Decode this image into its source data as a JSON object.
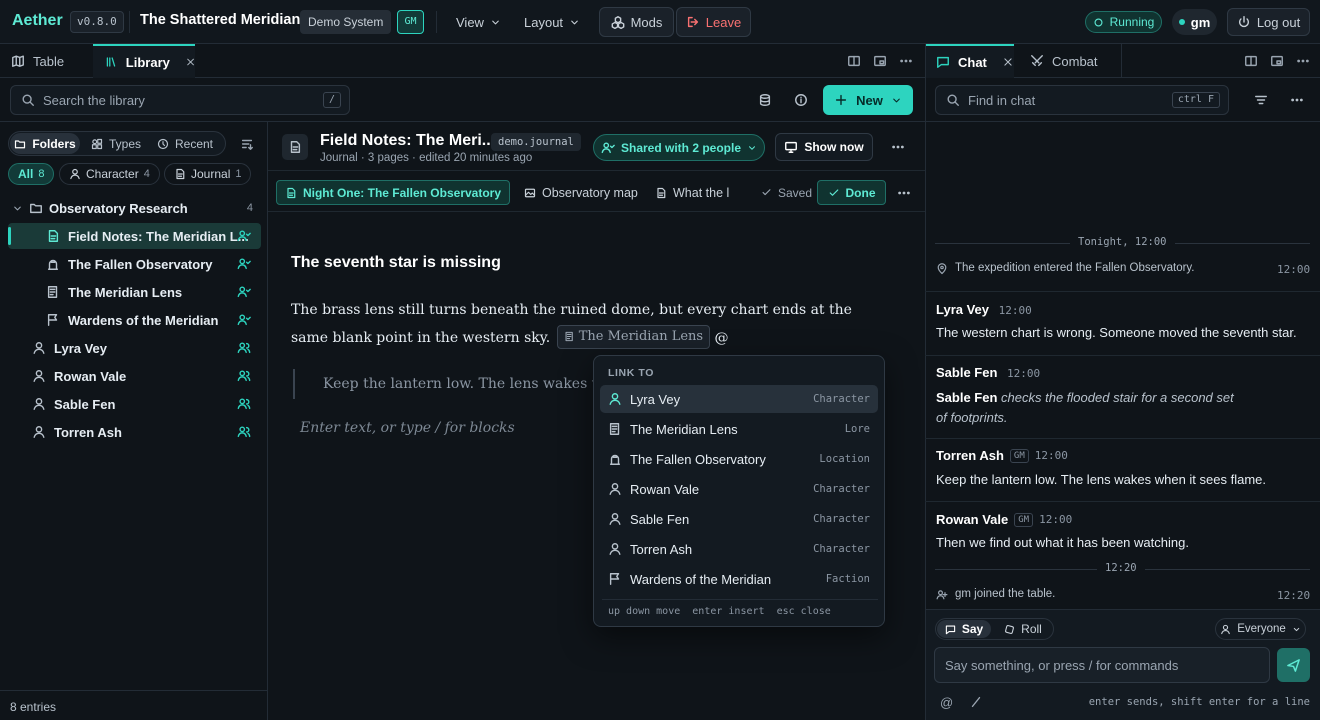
{
  "app": {
    "name": "Aether",
    "version": "v0.8.0",
    "world": "The Shattered Meridian",
    "system": "Demo System",
    "role": "GM"
  },
  "topbar": {
    "view": "View",
    "layout": "Layout",
    "mods": "Mods",
    "leave": "Leave",
    "status": "Running",
    "user": "gm",
    "logout": "Log out"
  },
  "left_tabs": {
    "table": "Table",
    "library": "Library"
  },
  "right_tabs": {
    "chat": "Chat",
    "combat": "Combat"
  },
  "library": {
    "search_placeholder": "Search the library",
    "search_key": "/",
    "new_label": "New",
    "views": [
      "Folders",
      "Types",
      "Recent"
    ],
    "filters": [
      {
        "label": "All",
        "count": "8"
      },
      {
        "label": "Character",
        "count": "4"
      },
      {
        "label": "Journal",
        "count": "1"
      }
    ],
    "folder": {
      "name": "Observatory Research",
      "count": "4"
    },
    "folder_items": [
      "Field Notes: The Meridian L...",
      "The Fallen Observatory",
      "The Meridian Lens",
      "Wardens of the Meridian"
    ],
    "characters": [
      "Lyra Vey",
      "Rowan Vale",
      "Sable Fen",
      "Torren Ash"
    ],
    "footer": "8 entries"
  },
  "document": {
    "title": "Field Notes: The Meri...",
    "type_tag": "demo.journal",
    "meta": "Journal · 3 pages · edited 20 minutes ago",
    "shared": "Shared with 2 people",
    "show_now": "Show now",
    "pages": [
      "Night One: The Fallen Observatory",
      "Observatory map",
      "What the l"
    ],
    "saved": "Saved",
    "done": "Done",
    "heading": "The seventh star is missing",
    "para_before": "The brass lens still turns beneath the ruined dome, but every chart ends at the same blank point in the western sky.",
    "inline_link": "The Meridian Lens",
    "at": "@",
    "quote": "Keep the lantern low. The lens wakes when it sees flame.",
    "placeholder": "Enter text, or type / for blocks"
  },
  "popup": {
    "heading": "LINK TO",
    "items": [
      {
        "label": "Lyra Vey",
        "kind": "Character",
        "icon": "person-icon"
      },
      {
        "label": "The Meridian Lens",
        "kind": "Lore",
        "icon": "lore-icon"
      },
      {
        "label": "The Fallen Observatory",
        "kind": "Location",
        "icon": "location-icon"
      },
      {
        "label": "Rowan Vale",
        "kind": "Character",
        "icon": "person-icon"
      },
      {
        "label": "Sable Fen",
        "kind": "Character",
        "icon": "person-icon"
      },
      {
        "label": "Torren Ash",
        "kind": "Character",
        "icon": "person-icon"
      },
      {
        "label": "Wardens of the Meridian",
        "kind": "Faction",
        "icon": "flag-icon"
      }
    ],
    "hint": "up down move  enter insert  esc close"
  },
  "chat": {
    "find_placeholder": "Find in chat",
    "find_key": "ctrl F",
    "day_label": "Tonight, 12:00",
    "event1": {
      "text": "The expedition entered the Fallen Observatory.",
      "time": "12:00"
    },
    "messages": [
      {
        "name": "Lyra Vey",
        "gm": "",
        "time": "12:00",
        "text": "The western chart is wrong. Someone moved the seventh star."
      },
      {
        "name": "Sable Fen",
        "gm": "",
        "time": "12:00",
        "actor": "Sable Fen",
        "action_line1": "checks the flooded stair for a second set",
        "action_line2": "of footprints."
      },
      {
        "name": "Torren Ash",
        "gm": "GM",
        "time": "12:00",
        "text": "Keep the lantern low. The lens wakes when it sees flame."
      },
      {
        "name": "Rowan Vale",
        "gm": "GM",
        "time": "12:00",
        "text": "Then we find out what it has been watching."
      }
    ],
    "time_divider": "12:20",
    "event2": {
      "text": "gm joined the table.",
      "time": "12:20"
    },
    "say": "Say",
    "roll": "Roll",
    "audience": "Everyone",
    "input_placeholder": "Say something, or press / for commands",
    "footer_hint": "enter sends, shift enter for a line"
  },
  "colors": {
    "accent": "#2dd4bf",
    "danger": "#f87171",
    "bg": "#0f1419"
  }
}
